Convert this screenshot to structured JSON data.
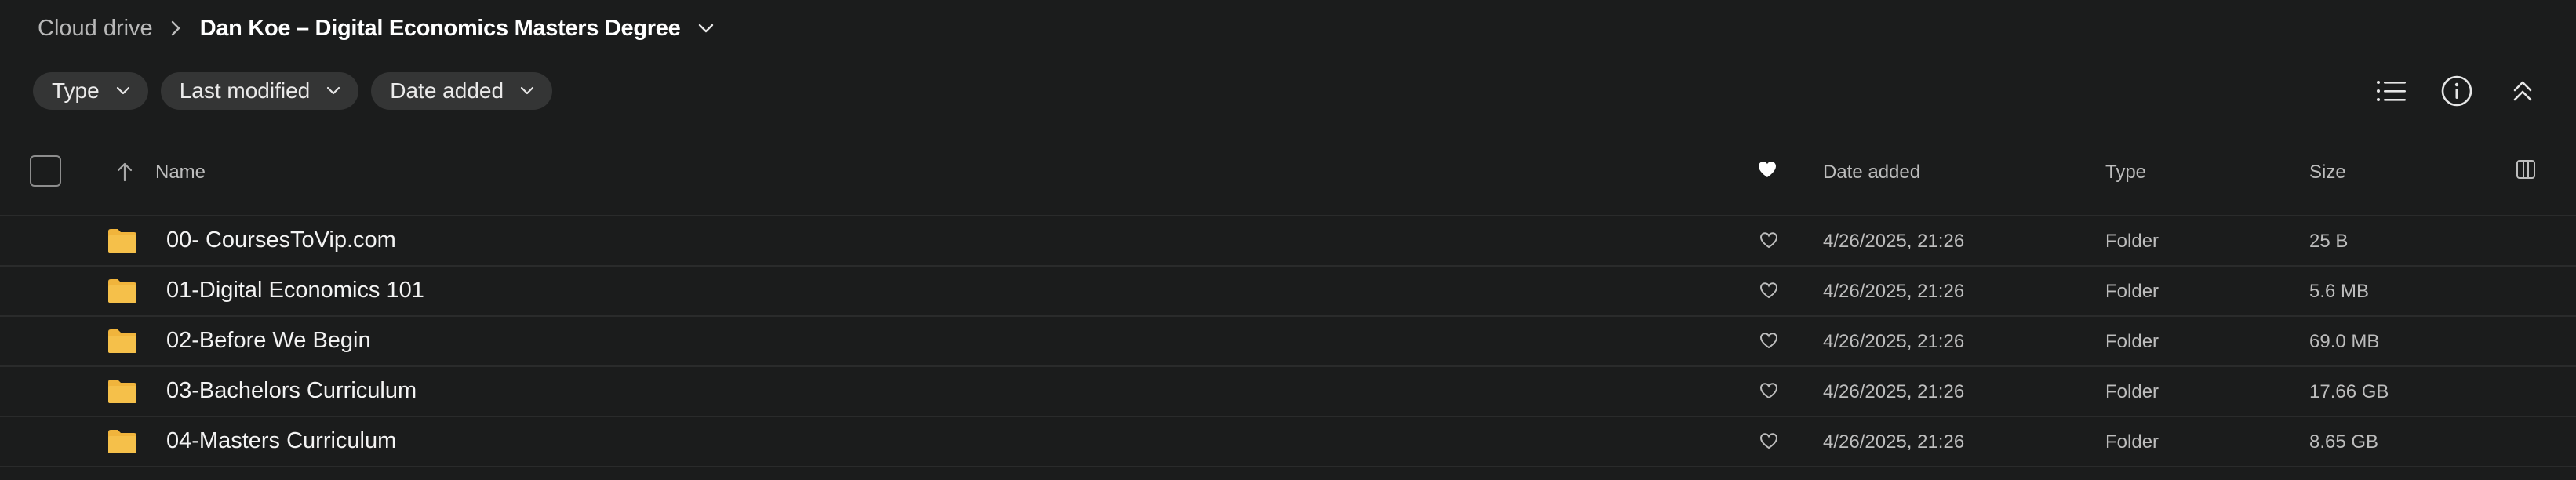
{
  "breadcrumb": {
    "root": "Cloud drive",
    "current": "Dan Koe – Digital Economics Masters Degree"
  },
  "filters": {
    "type": "Type",
    "last_modified": "Last modified",
    "date_added": "Date added"
  },
  "table": {
    "headers": {
      "name": "Name",
      "date_added": "Date added",
      "type": "Type",
      "size": "Size"
    },
    "rows": [
      {
        "name": "00- CoursesToVip.com",
        "date": "4/26/2025, 21:26",
        "type": "Folder",
        "size": "25 B"
      },
      {
        "name": "01-Digital Economics 101",
        "date": "4/26/2025, 21:26",
        "type": "Folder",
        "size": "5.6 MB"
      },
      {
        "name": "02-Before We Begin",
        "date": "4/26/2025, 21:26",
        "type": "Folder",
        "size": "69.0 MB"
      },
      {
        "name": "03-Bachelors Curriculum",
        "date": "4/26/2025, 21:26",
        "type": "Folder",
        "size": "17.66 GB"
      },
      {
        "name": "04-Masters Curriculum",
        "date": "4/26/2025, 21:26",
        "type": "Folder",
        "size": "8.65 GB"
      }
    ]
  },
  "colors": {
    "background": "#1b1c1c",
    "pill": "#343535",
    "folder": "#f0b43c",
    "divider": "#2a2b2b"
  },
  "icons": [
    "chevron-right-icon",
    "chevron-down-icon",
    "list-view-icon",
    "info-icon",
    "collapse-icon",
    "sort-up-icon",
    "heart-filled-icon",
    "heart-outline-icon",
    "columns-icon",
    "folder-icon"
  ]
}
